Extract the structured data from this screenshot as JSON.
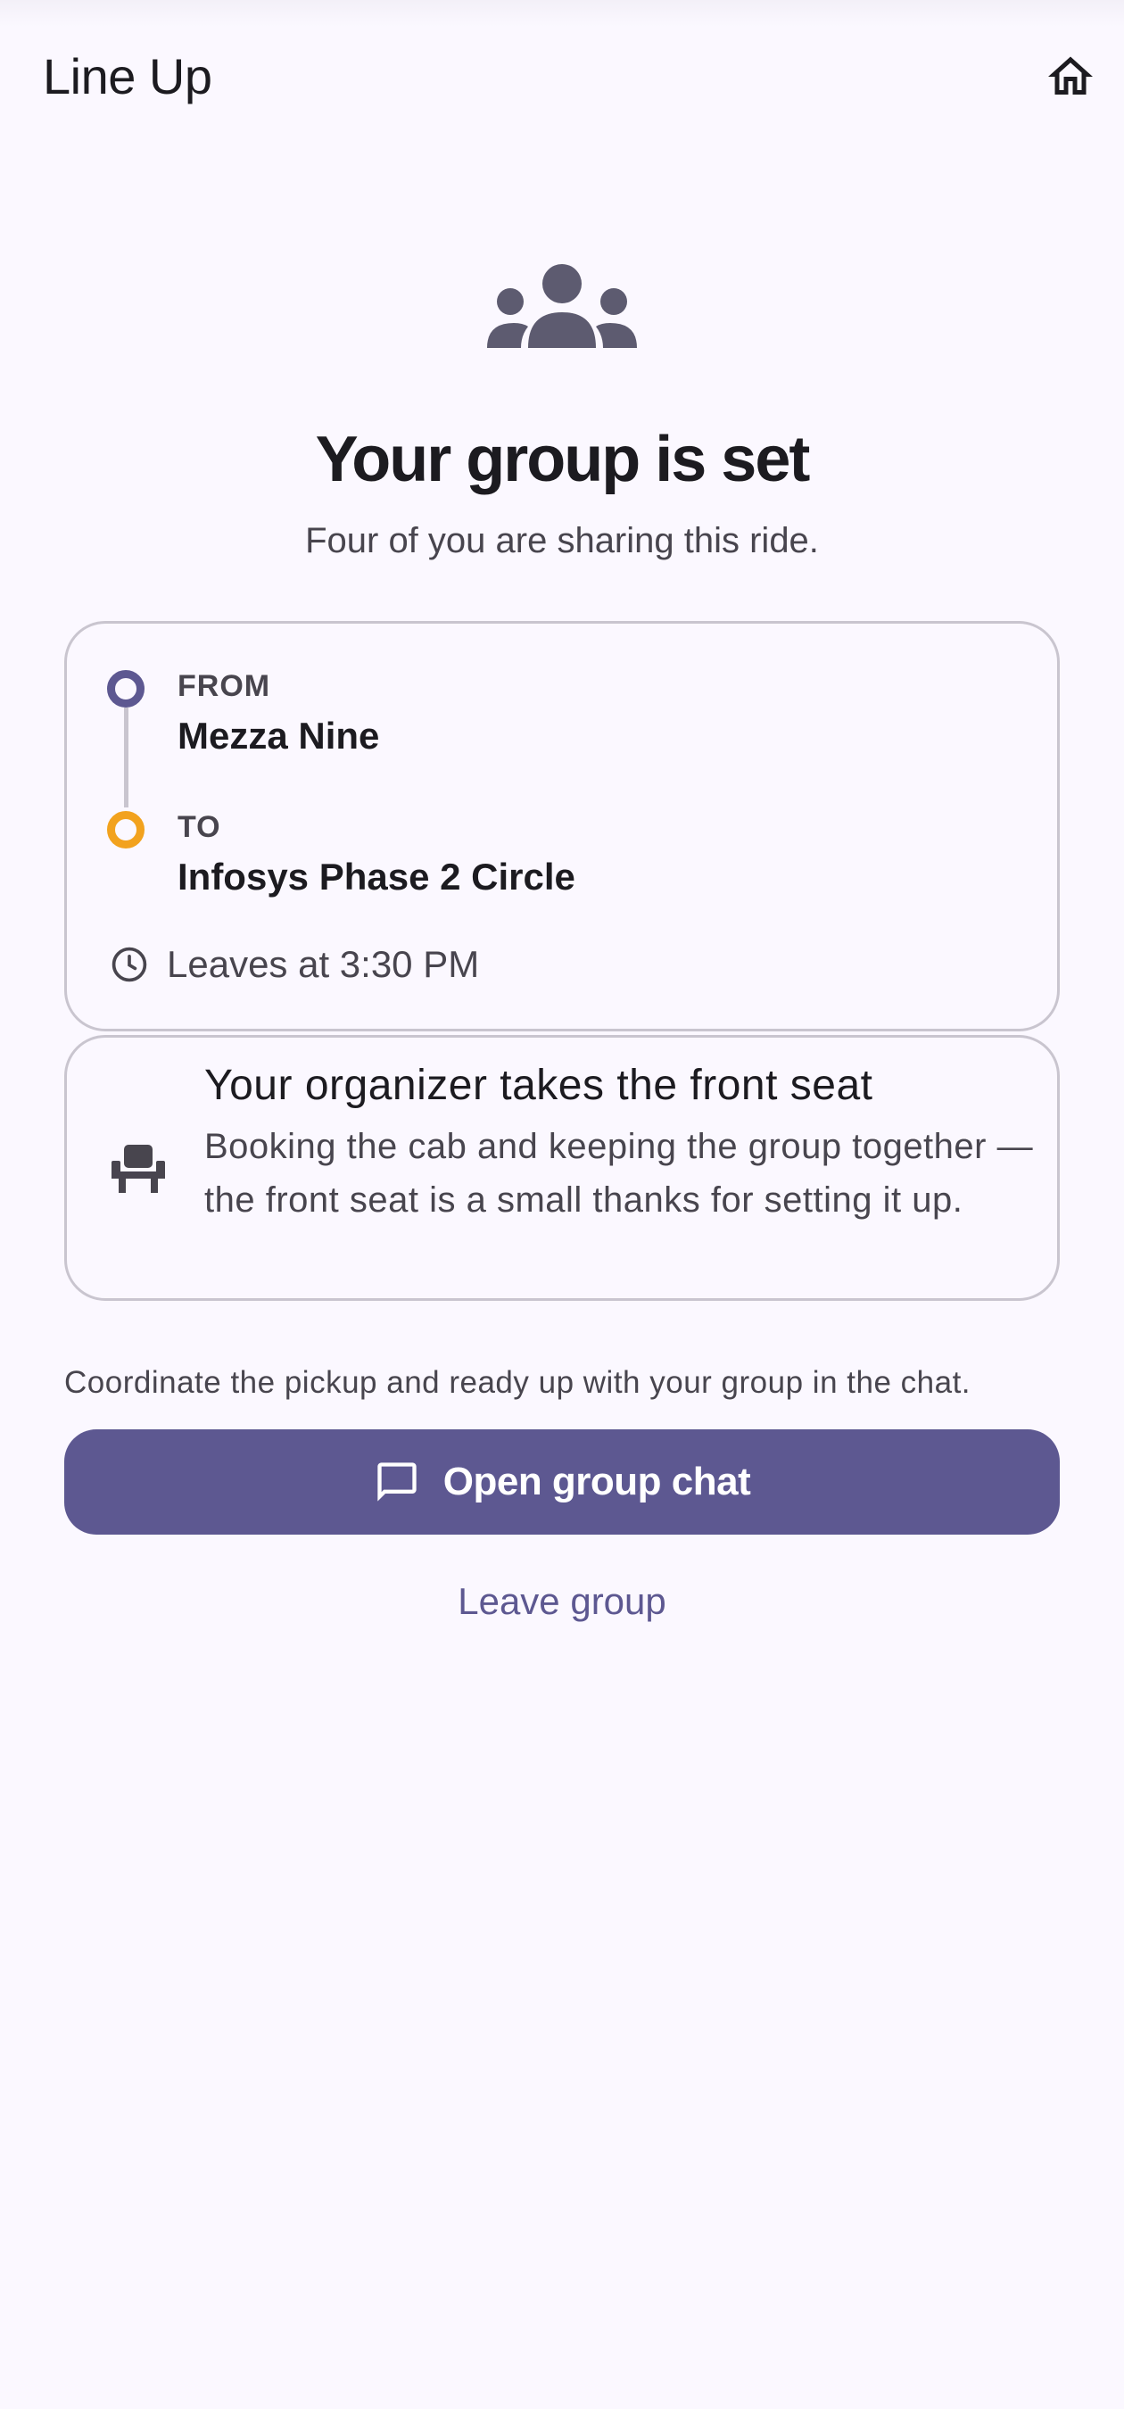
{
  "app_bar": {
    "title": "Line Up",
    "home_icon": "home-icon"
  },
  "hero": {
    "icon": "groups-icon",
    "title": "Your group is set",
    "subtitle": "Four of you are sharing this ride."
  },
  "route": {
    "from_label": "FROM",
    "from_name": "Mezza Nine",
    "to_label": "TO",
    "to_name": "Infosys Phase 2 Circle",
    "departure": "Leaves at 3:30 PM",
    "from_color": "#5d5891",
    "to_color": "#f2a21e"
  },
  "organizer": {
    "icon": "seat-icon",
    "title": "Your organizer takes the front seat",
    "body": "Booking the cab and keeping the group together — the front seat is a small thanks for setting it up."
  },
  "actions": {
    "hint": "Coordinate the pickup and ready up with your group in the chat.",
    "chat_button": "Open group chat",
    "leave_button": "Leave group"
  },
  "colors": {
    "primary": "#5d5891",
    "accent": "#f2a21e",
    "background": "#fbf8ff"
  }
}
